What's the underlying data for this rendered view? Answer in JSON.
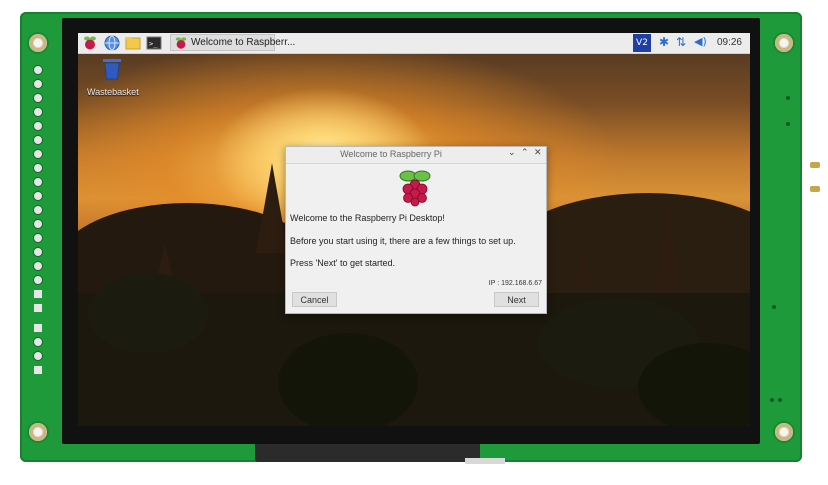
{
  "taskbar": {
    "window_button_label": "Welcome to Raspberr...",
    "clock": "09:26",
    "vnc_label": "V2",
    "icons": [
      "raspberry-menu-icon",
      "web-browser-icon",
      "file-manager-icon",
      "terminal-icon",
      "vnc-icon",
      "bluetooth-icon",
      "network-icon",
      "volume-icon"
    ]
  },
  "desktop": {
    "wastebasket_label": "Wastebasket"
  },
  "dialog": {
    "title": "Welcome to Raspberry Pi",
    "line1": "Welcome to the Raspberry Pi Desktop!",
    "line2": "Before you start using it, there are a few things to set up.",
    "line3": "Press 'Next' to get started.",
    "ip": "IP : 192.168.6.67",
    "cancel_label": "Cancel",
    "next_label": "Next"
  },
  "colors": {
    "pcb": "#1f9a3a",
    "vnc_badge": "#1f3fa5",
    "raspberry_red": "#c51a4a",
    "leaf_green": "#6cc04a"
  }
}
